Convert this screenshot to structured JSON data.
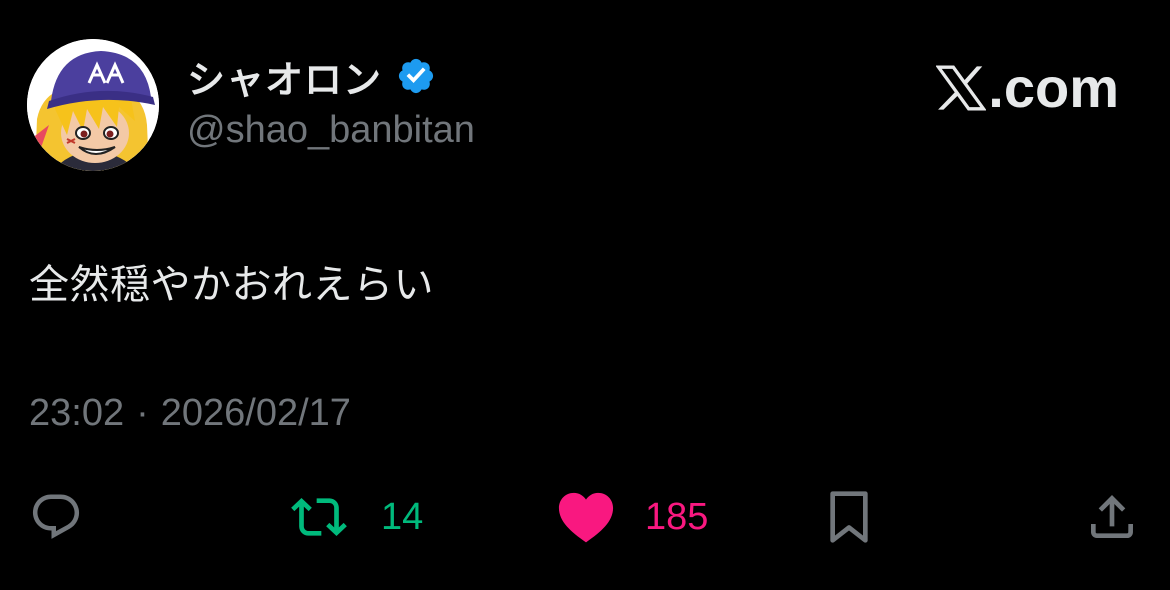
{
  "user": {
    "display_name": "シャオロン",
    "handle": "@shao_banbitan",
    "verified_icon": "verified-badge-icon",
    "avatar_icon": "avatar-image"
  },
  "brand": {
    "text": ".com",
    "logo_icon": "x-logo-icon"
  },
  "tweet": {
    "text": "全然穏やかおれえらい",
    "time": "23:02",
    "separator": "·",
    "date": "2026/02/17"
  },
  "actions": {
    "reply_icon": "reply-icon",
    "retweet_icon": "retweet-icon",
    "retweet_count": "14",
    "like_icon": "heart-icon",
    "like_count": "185",
    "bookmark_icon": "bookmark-icon",
    "share_icon": "share-icon"
  },
  "colors": {
    "background": "#000000",
    "primary_text": "#e7e9ea",
    "secondary_text": "#71767b",
    "verified": "#1d9bf0",
    "retweet": "#00ba7c",
    "like": "#f91880"
  }
}
